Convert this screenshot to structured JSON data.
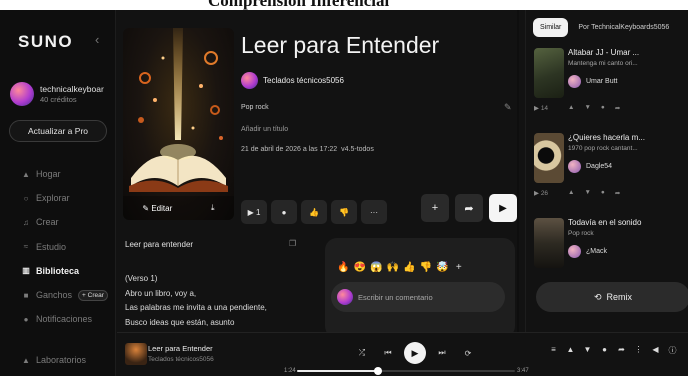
{
  "page_caption": "Comprensión Inferencial",
  "sidebar": {
    "logo": "SUNO",
    "collapse_icon": "chevron-left-icon",
    "user": {
      "name": "technicalkeyboar",
      "credits": "40 créditos"
    },
    "upgrade_label": "Actualizar a Pro",
    "nav": [
      {
        "icon": "home-icon",
        "label": "Hogar"
      },
      {
        "icon": "search-icon",
        "label": "Explorar"
      },
      {
        "icon": "music-note-icon",
        "label": "Crear"
      },
      {
        "icon": "studio-icon",
        "label": "Estudio"
      },
      {
        "icon": "library-icon",
        "label": "Biblioteca",
        "active": true
      },
      {
        "icon": "hooks-icon",
        "label": "Ganchos",
        "pill": "+ Crear"
      },
      {
        "icon": "bell-icon",
        "label": "Notificaciones"
      }
    ],
    "labs": {
      "icon": "flask-icon",
      "label": "Laboratorios"
    }
  },
  "song": {
    "title": "Leer para Entender",
    "author": "Teclados técnicos5056",
    "genre": "Pop rock",
    "add_title": "Añadir un título",
    "date": "21 de abril de 2026 a las 17:22",
    "version": "v4.5-todos",
    "edit_label": "Editar",
    "play_count": "1"
  },
  "lyrics": {
    "heading": "Leer para entender",
    "lines": [
      "(Verso 1)",
      "Abro un libro, voy a,",
      "Las palabras me invita a una pendiente,",
      "Busco ideas que están, asunto"
    ]
  },
  "comments": {
    "reactions": [
      "🔥",
      "😍",
      "😱",
      "🙌",
      "👍",
      "👎",
      "🤯"
    ],
    "placeholder": "Escribir un comentario"
  },
  "right_panel": {
    "tabs": [
      {
        "label": "Similar",
        "active": true
      },
      {
        "label": "Por TechnicalKeyboards5056",
        "active": false
      }
    ],
    "cards": [
      {
        "title": "Altabar JJ - Umar ...",
        "subtitle": "Mantenga mi canto ori...",
        "author": "Umar Butt",
        "plays": "14"
      },
      {
        "title": "¿Quieres hacerla m...",
        "subtitle": "1970 pop rock cantant...",
        "author": "Dagle54",
        "plays": "26"
      },
      {
        "title": "Todavía en el sonido",
        "subtitle": "Pop rock",
        "author": "¿Mack",
        "plays": ""
      }
    ],
    "remix_label": "Remix"
  },
  "player": {
    "title": "Leer para Entender",
    "author": "Teclados técnicos5056",
    "current_time": "1:24",
    "total_time": "3:47",
    "progress": 0.37
  }
}
